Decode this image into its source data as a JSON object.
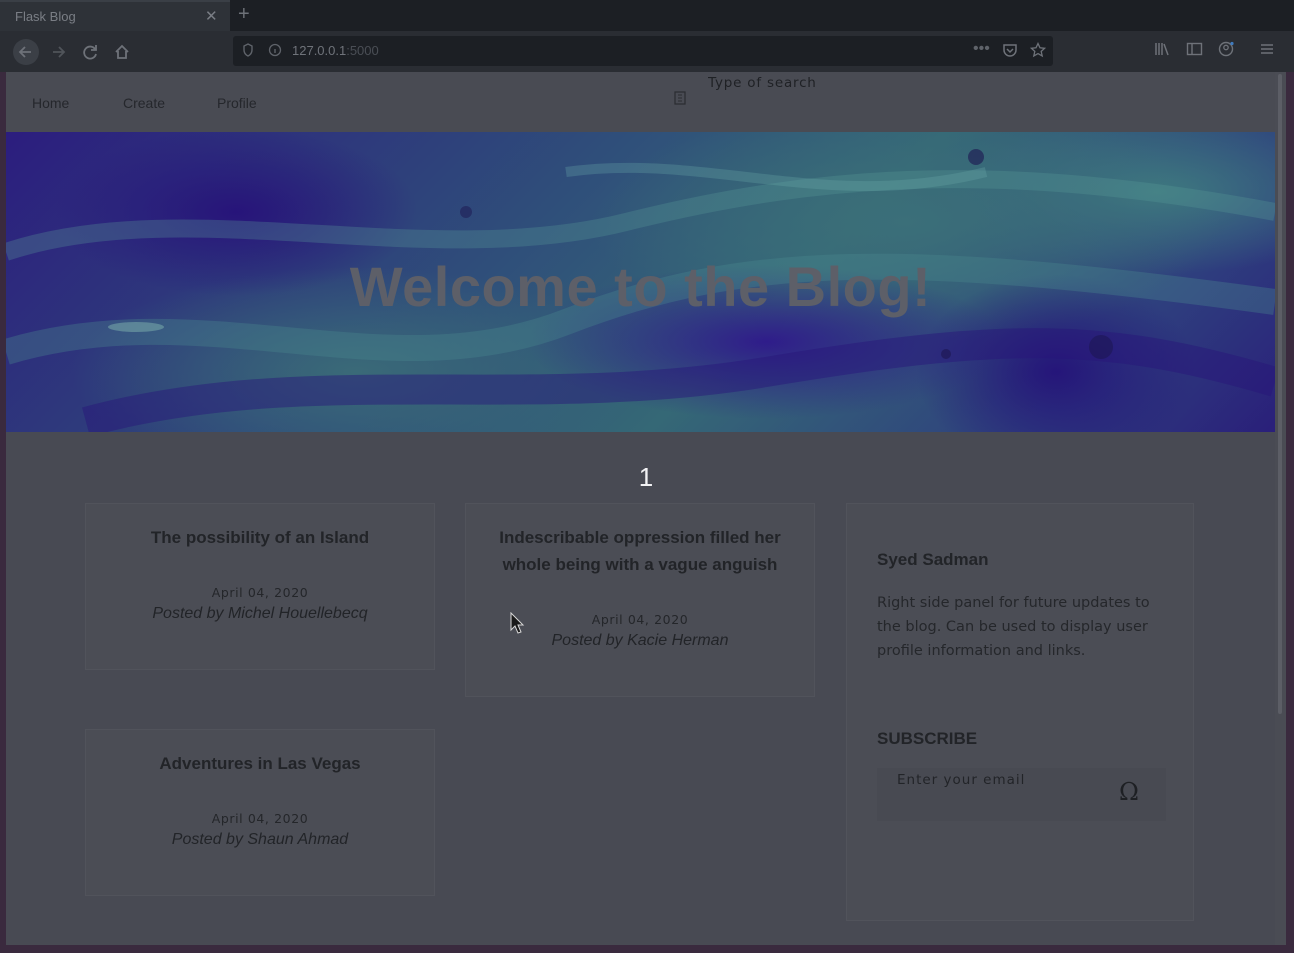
{
  "browser": {
    "tab_title": "Flask Blog",
    "tab_close": "✕",
    "new_tab": "+",
    "url_host": "127.0.0.1",
    "url_port": ":5000"
  },
  "nav": {
    "items": [
      {
        "label": "Home"
      },
      {
        "label": "Create"
      },
      {
        "label": "Profile"
      }
    ],
    "search_placeholder": "Type of search"
  },
  "hero": {
    "title": "Welcome to the Blog!"
  },
  "pagination": {
    "current": "1"
  },
  "posts": [
    {
      "title": "The possibility of an Island",
      "date": "April 04, 2020",
      "author": "Posted by Michel Houellebecq"
    },
    {
      "title": "Indescribable oppression filled her whole being with a vague anguish",
      "date": "April 04, 2020",
      "author": "Posted by Kacie Herman"
    },
    {
      "title": "Adventures in Las Vegas",
      "date": "April 04, 2020",
      "author": "Posted by Shaun Ahmad"
    }
  ],
  "sidebar": {
    "name": "Syed Sadman",
    "description": "Right side panel for future updates to the blog. Can be used to display user profile information and links.",
    "subscribe_heading": "SUBSCRIBE",
    "email_placeholder": "Enter your email"
  },
  "icons": {
    "back": "back-arrow-icon",
    "forward": "forward-arrow-icon",
    "reload": "reload-icon",
    "home": "home-icon",
    "search": "search-icon",
    "submit": "submit-icon"
  },
  "colors": {
    "page_overlay": "#484a53",
    "hero_purple": "#2c1d7e",
    "hero_teal": "#3e7980"
  }
}
